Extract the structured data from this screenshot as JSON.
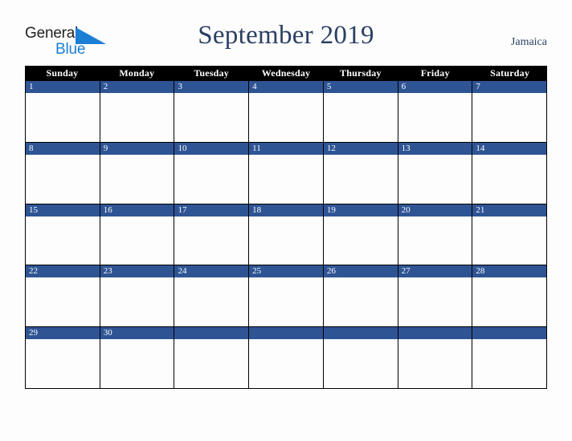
{
  "branding": {
    "logo_line1": "General",
    "logo_line2": "Blue",
    "logo_triangle_icon": "triangle-icon",
    "logo_line1_color": "#231f20",
    "logo_line2_color": "#1b7fd4"
  },
  "header": {
    "title": "September 2019",
    "locale": "Jamaica",
    "title_color": "#2b3f63",
    "locale_color": "#2b3f63"
  },
  "calendar": {
    "weekday_headers": [
      "Sunday",
      "Monday",
      "Tuesday",
      "Wednesday",
      "Thursday",
      "Friday",
      "Saturday"
    ],
    "header_bg": "#000000",
    "header_text_color": "#ffffff",
    "day_bar_bg": "#2e5494",
    "day_bar_text_color": "#ffffff",
    "cell_bg": "#fdfdfd",
    "grid_line_color": "#000000",
    "weeks": [
      {
        "days": [
          "1",
          "2",
          "3",
          "4",
          "5",
          "6",
          "7"
        ]
      },
      {
        "days": [
          "8",
          "9",
          "10",
          "11",
          "12",
          "13",
          "14"
        ]
      },
      {
        "days": [
          "15",
          "16",
          "17",
          "18",
          "19",
          "20",
          "21"
        ]
      },
      {
        "days": [
          "22",
          "23",
          "24",
          "25",
          "26",
          "27",
          "28"
        ]
      },
      {
        "days": [
          "29",
          "30",
          "",
          "",
          "",
          "",
          ""
        ]
      }
    ]
  }
}
